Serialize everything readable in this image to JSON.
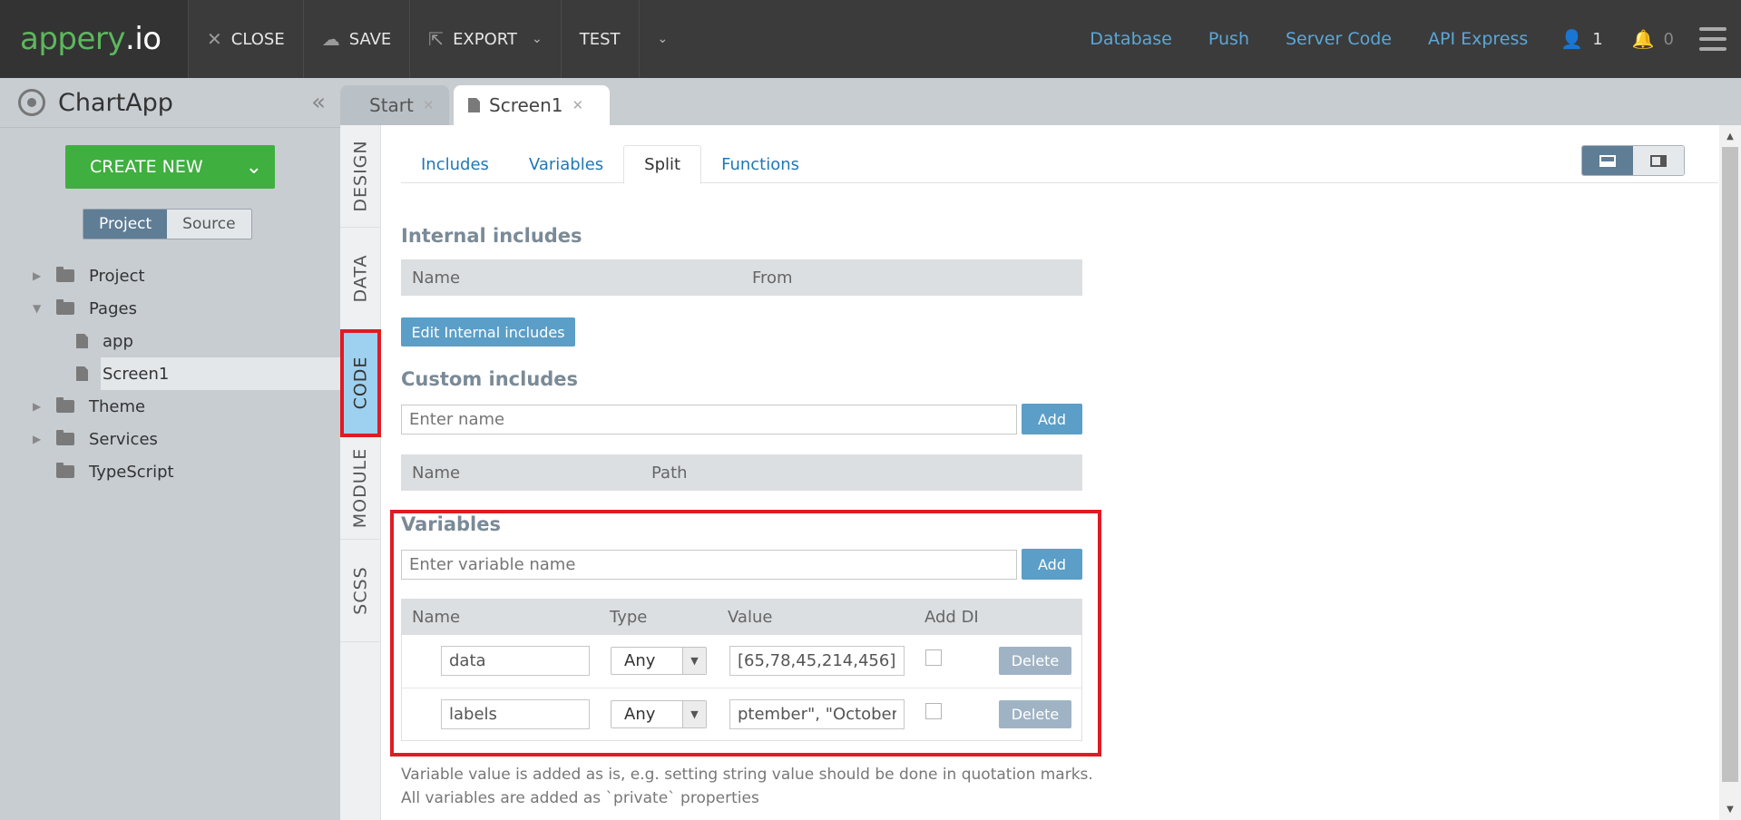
{
  "topbar": {
    "logo_main": "appery",
    "logo_suffix": ".io",
    "close_label": "CLOSE",
    "save_label": "SAVE",
    "export_label": "EXPORT",
    "test_label": "TEST",
    "links": [
      "Database",
      "Push",
      "Server Code",
      "API Express"
    ],
    "users_count": "1",
    "notifications_count": "0"
  },
  "sidebar": {
    "app_name": "ChartApp",
    "create_label": "CREATE NEW",
    "project_label": "Project",
    "source_label": "Source",
    "tree": [
      "Project",
      "Pages",
      "app",
      "Screen1",
      "Theme",
      "Services",
      "TypeScript"
    ]
  },
  "tabs": {
    "start": "Start",
    "screen": "Screen1"
  },
  "vtabs": [
    "DESIGN",
    "DATA",
    "CODE",
    "MODULE",
    "SCSS"
  ],
  "subtabs": [
    "Includes",
    "Variables",
    "Split",
    "Functions"
  ],
  "internal": {
    "title": "Internal includes",
    "col_name": "Name",
    "col_from": "From",
    "edit_label": "Edit Internal includes"
  },
  "custom": {
    "title": "Custom includes",
    "placeholder": "Enter name",
    "add_label": "Add",
    "col_name": "Name",
    "col_path": "Path"
  },
  "variables": {
    "title": "Variables",
    "placeholder": "Enter variable name",
    "add_label": "Add",
    "columns": [
      "Name",
      "Type",
      "Value",
      "Add DI"
    ],
    "rows": [
      {
        "name": "data",
        "type": "Any",
        "value": "[65,78,45,214,456]",
        "delete": "Delete"
      },
      {
        "name": "labels",
        "type": "Any",
        "value": "ptember\", \"October\"]",
        "delete": "Delete"
      }
    ],
    "note1": "Variable value is added as is, e.g. setting string value should be done in quotation marks.",
    "note2": "All variables are added as `private` properties"
  },
  "colors": {
    "accent_green": "#3faf3f",
    "link_blue": "#5ba7d8",
    "highlight_red": "#e01b24",
    "active_tab": "#9ed0ef"
  }
}
